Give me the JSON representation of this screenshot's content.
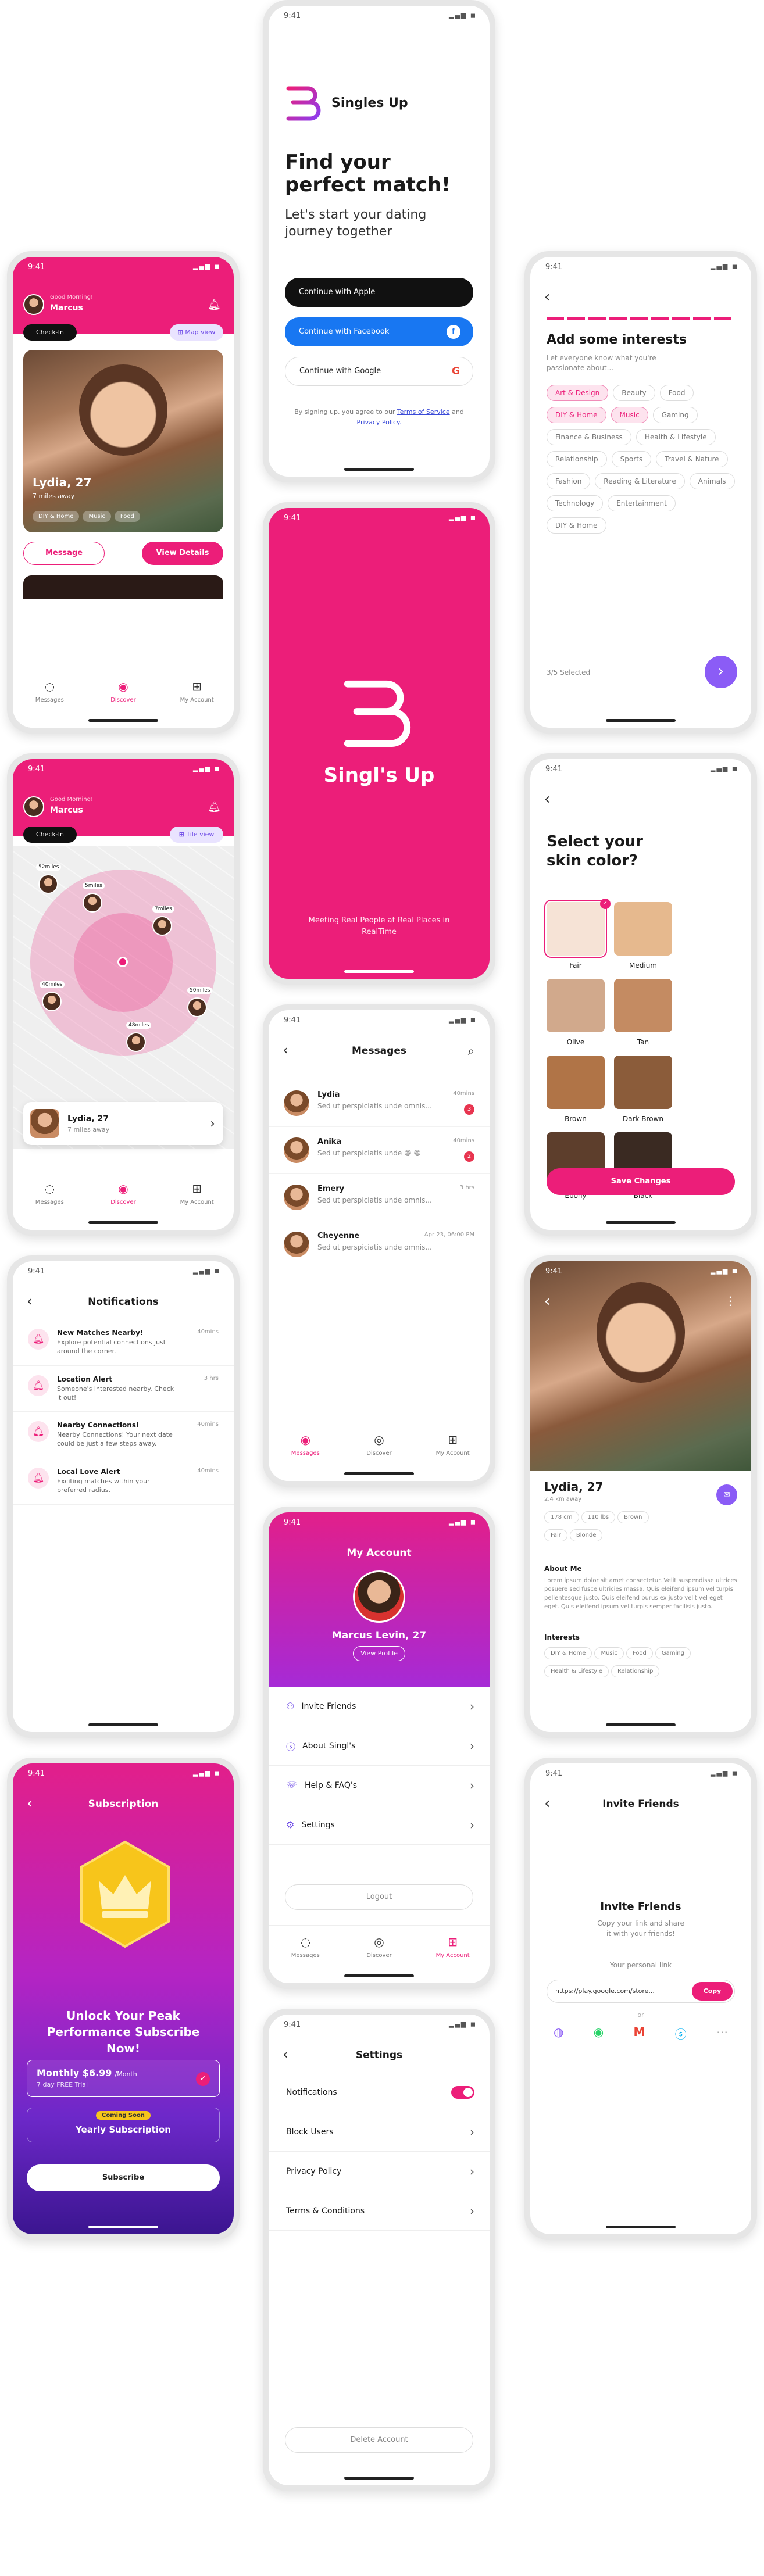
{
  "status_time": "9:41",
  "signup": {
    "brand": "Singles Up",
    "headline": "Find your perfect match!",
    "sub": "Let's start your dating journey together",
    "apple": "Continue with Apple",
    "facebook": "Continue with Facebook",
    "google": "Continue with Google",
    "terms_prefix": "By signing up, you agree to our",
    "terms_link": "Terms of Service",
    "terms_and": "and",
    "privacy_link": "Privacy Policy."
  },
  "splash": {
    "brand": "Singl's Up",
    "tagline": "Meeting Real People at Real Places in RealTime"
  },
  "home": {
    "greeting": "Good Morning!",
    "user": "Marcus",
    "checkin": "Check-In",
    "map_view": "Map view",
    "tile_view": "Tile view",
    "profile_name": "Lydia, 27",
    "profile_dist": "7 miles away",
    "tags": [
      "DIY & Home",
      "Music",
      "Food"
    ],
    "message_btn": "Message",
    "details_btn": "View Details",
    "map_labels": [
      "52miles",
      "5miles",
      "7miles",
      "40miles",
      "48miles",
      "50miles"
    ],
    "card_name": "Lydia, 27",
    "card_dist": "7 miles away"
  },
  "nav": {
    "messages": "Messages",
    "discover": "Discover",
    "account": "My Account"
  },
  "interests": {
    "title": "Add some interests",
    "sub": "Let everyone know what you're passionate about...",
    "chips": [
      {
        "label": "Art & Design",
        "sel": true
      },
      {
        "label": "Beauty",
        "sel": false
      },
      {
        "label": "Food",
        "sel": false
      },
      {
        "label": "DIY & Home",
        "sel": true
      },
      {
        "label": "Music",
        "sel": true
      },
      {
        "label": "Gaming",
        "sel": false
      },
      {
        "label": "Finance & Business",
        "sel": false
      },
      {
        "label": "Health & Lifestyle",
        "sel": false
      },
      {
        "label": "Relationship",
        "sel": false
      },
      {
        "label": "Sports",
        "sel": false
      },
      {
        "label": "Travel & Nature",
        "sel": false
      },
      {
        "label": "Fashion",
        "sel": false
      },
      {
        "label": "Reading & Literature",
        "sel": false
      },
      {
        "label": "Animals",
        "sel": false
      },
      {
        "label": "Technology",
        "sel": false
      },
      {
        "label": "Entertainment",
        "sel": false
      },
      {
        "label": "DIY & Home",
        "sel": false
      }
    ],
    "count": "3/5 Selected"
  },
  "skin": {
    "title": "Select your skin color?",
    "swatches": [
      {
        "label": "Fair",
        "color": "#f6e3d6"
      },
      {
        "label": "Medium",
        "color": "#e6b98e"
      },
      {
        "label": "Olive",
        "color": "#d1a98c"
      },
      {
        "label": "Tan",
        "color": "#c48b62"
      },
      {
        "label": "Brown",
        "color": "#b07447"
      },
      {
        "label": "Dark Brown",
        "color": "#8b5c3a"
      },
      {
        "label": "Ebony",
        "color": "#5d3e2c"
      },
      {
        "label": "Black",
        "color": "#3a2a22"
      }
    ],
    "save": "Save Changes"
  },
  "notifications": {
    "title": "Notifications",
    "items": [
      {
        "title": "New Matches Nearby!",
        "desc": "Explore potential connections just around the corner.",
        "time": "40mins"
      },
      {
        "title": "Location Alert",
        "desc": "Someone's interested nearby. Check it out!",
        "time": "3 hrs"
      },
      {
        "title": "Nearby Connections!",
        "desc": "Nearby Connections! Your next date could be just a few steps away.",
        "time": "40mins"
      },
      {
        "title": "Local Love Alert",
        "desc": "Exciting matches within your preferred radius.",
        "time": "40mins"
      }
    ]
  },
  "messages": {
    "title": "Messages",
    "items": [
      {
        "name": "Lydia",
        "preview": "Sed ut perspiciatis unde omnis...",
        "time": "40mins",
        "count": "3"
      },
      {
        "name": "Anika",
        "preview": "Sed ut perspiciatis unde 😄 😄",
        "time": "40mins",
        "count": "2"
      },
      {
        "name": "Emery",
        "preview": "Sed ut perspiciatis unde omnis...",
        "time": "3 hrs",
        "count": ""
      },
      {
        "name": "Cheyenne",
        "preview": "Sed ut perspiciatis unde omnis...",
        "time": "Apr 23, 06:00 PM",
        "count": ""
      }
    ]
  },
  "detail": {
    "name": "Lydia, 27",
    "dist": "2.4 km away",
    "stats": [
      "178 cm",
      "110 lbs",
      "Brown",
      "Fair",
      "Blonde"
    ],
    "about_title": "About Me",
    "about": "Lorem ipsum dolor sit amet consectetur. Velit suspendisse ultrices posuere sed fusce ultricies massa. Quis eleifend ipsum vel turpis pellentesque justo. Quis eleifend purus ex justo velit vel eget eget. Quis eleifend ipsum vel turpis semper facilisis justo.",
    "interests_title": "Interests",
    "interests": [
      "DIY & Home",
      "Music",
      "Food",
      "Gaming",
      "Health & Lifestyle",
      "Relationship"
    ]
  },
  "account": {
    "title": "My Account",
    "name": "Marcus Levin, 27",
    "view": "View Profile",
    "items": [
      "Invite Friends",
      "About Singl's",
      "Help & FAQ's",
      "Settings"
    ],
    "logout": "Logout"
  },
  "subscription": {
    "title": "Subscription",
    "headline": "Unlock Your Peak Performance Subscribe Now!",
    "monthly": "Monthly $6.99",
    "monthly_unit": "/Month",
    "trial": "7 day FREE Trial",
    "coming": "Coming Soon",
    "yearly": "Yearly Subscription",
    "cta": "Subscribe"
  },
  "invite": {
    "title": "Invite Friends",
    "heading": "Invite Friends",
    "sub": "Copy your link and share it with your friends!",
    "link_label": "Your personal link",
    "link": "https://play.google.com/store...",
    "copy": "Copy",
    "or": "or"
  },
  "settings": {
    "title": "Settings",
    "items": [
      "Notifications",
      "Block Users",
      "Privacy Policy",
      "Terms & Conditions"
    ],
    "delete": "Delete Account"
  },
  "colors": {
    "brand": "#ec1e79",
    "purple": "#8b5cf6"
  }
}
